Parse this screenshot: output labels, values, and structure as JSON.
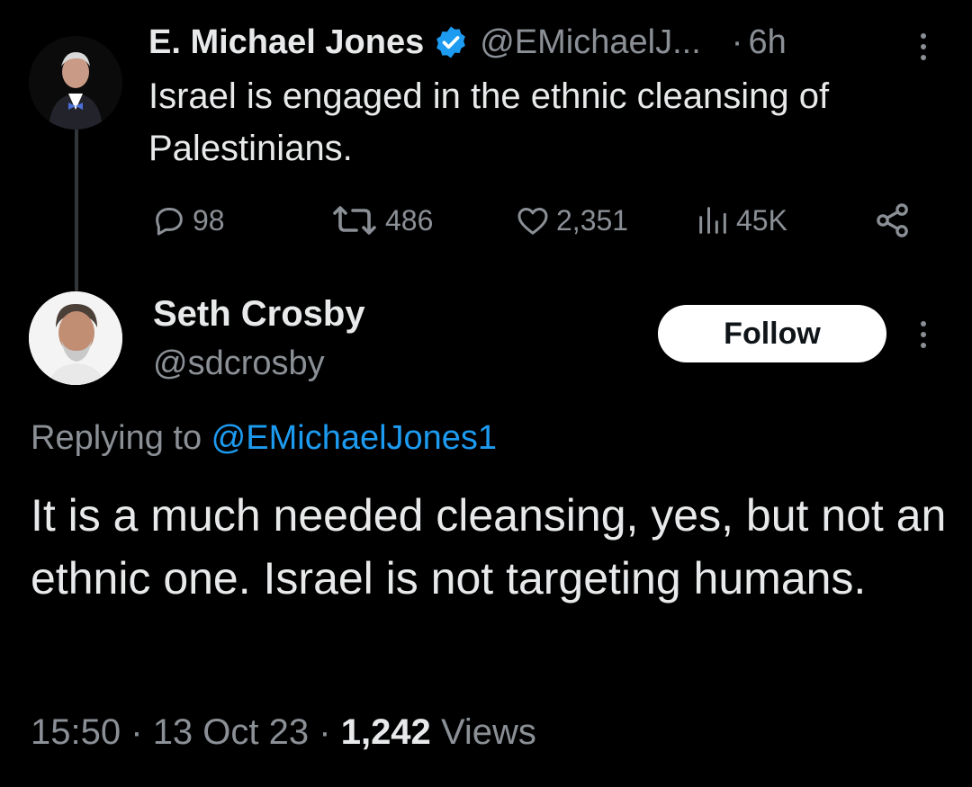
{
  "parent_tweet": {
    "author_name": "E. Michael Jones",
    "author_handle": "@EMichaelJ...",
    "separator": "·",
    "time": "6h",
    "text": "Israel is engaged in the ethnic cleansing of Palestinians.",
    "actions": {
      "replies": "98",
      "retweets": "486",
      "likes": "2,351",
      "views": "45K"
    }
  },
  "reply_tweet": {
    "author_name": "Seth Crosby",
    "author_handle": "@sdcrosby",
    "follow_label": "Follow",
    "replying_to_prefix": "Replying to ",
    "replying_to_handle": "@EMichaelJones1",
    "text": "It is a much needed cleansing, yes, but not an ethnic one. Israel is not targeting humans.",
    "time": "15:50",
    "date": "13 Oct 23",
    "separator": "·",
    "views_count": "1,242",
    "views_label": "Views"
  },
  "icons": {
    "verified": "verified-badge-icon",
    "more": "more-vertical-icon",
    "reply": "reply-bubble-icon",
    "retweet": "retweet-icon",
    "like": "heart-icon",
    "views": "views-bar-icon",
    "share": "share-icon"
  },
  "colors": {
    "background": "#000000",
    "text_primary": "#e7e9ea",
    "text_secondary": "#8b9096",
    "accent": "#1d9bf0",
    "follow_button_bg": "#ffffff"
  }
}
